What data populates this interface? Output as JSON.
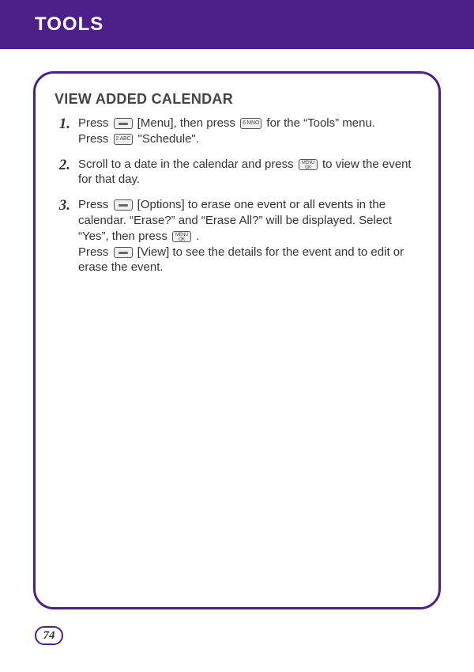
{
  "header": {
    "title": "TOOLS"
  },
  "section": {
    "title": "VIEW ADDED CALENDAR"
  },
  "steps": [
    {
      "num": "1.",
      "parts": [
        {
          "t": "text",
          "v": "Press "
        },
        {
          "t": "btn",
          "v": "soft",
          "name": "left-soft-key-icon"
        },
        {
          "t": "text",
          "v": " [Menu], then press "
        },
        {
          "t": "btn",
          "v": "6 MNO",
          "name": "key-6-icon"
        },
        {
          "t": "text",
          "v": " for the “Tools” menu."
        },
        {
          "t": "br"
        },
        {
          "t": "text",
          "v": "Press "
        },
        {
          "t": "btn",
          "v": "2 ABC",
          "name": "key-2-icon"
        },
        {
          "t": "text",
          "v": " \"Schedule\"."
        }
      ]
    },
    {
      "num": "2.",
      "parts": [
        {
          "t": "text",
          "v": "Scroll to a date in the calendar and press "
        },
        {
          "t": "btn",
          "v": "MENU OK",
          "name": "menu-ok-key-icon"
        },
        {
          "t": "text",
          "v": " to view the event for that day."
        }
      ]
    },
    {
      "num": "3.",
      "parts": [
        {
          "t": "text",
          "v": "Press "
        },
        {
          "t": "btn",
          "v": "soft",
          "name": "left-soft-key-icon"
        },
        {
          "t": "text",
          "v": " [Options] to erase one event or all events in the calendar. “Erase?” and “Erase All?” will be displayed.  Select “Yes”, then press "
        },
        {
          "t": "btn",
          "v": "MENU OK",
          "name": "menu-ok-key-icon"
        },
        {
          "t": "text",
          "v": " ."
        },
        {
          "t": "br"
        },
        {
          "t": "text",
          "v": "Press "
        },
        {
          "t": "btn",
          "v": "soft",
          "name": "right-soft-key-icon"
        },
        {
          "t": "text",
          "v": " [View] to see the details for the event and to edit or erase the event."
        }
      ]
    }
  ],
  "page_number": "74"
}
